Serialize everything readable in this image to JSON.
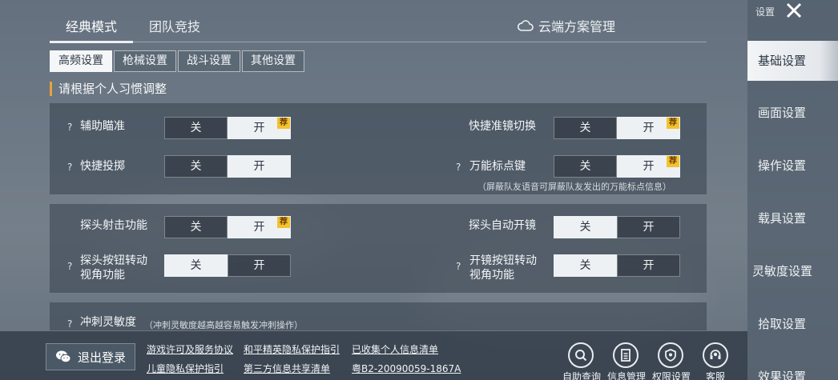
{
  "mode_tabs": [
    {
      "label": "经典模式",
      "active": true
    },
    {
      "label": "团队竞技",
      "active": false
    }
  ],
  "cloud_management": "云端方案管理",
  "sub_tabs": [
    {
      "label": "高频设置",
      "active": true
    },
    {
      "label": "枪械设置",
      "active": false
    },
    {
      "label": "战斗设置",
      "active": false
    },
    {
      "label": "其他设置",
      "active": false
    }
  ],
  "section_title": "请根据个人习惯调整",
  "toggle_labels": {
    "off": "关",
    "on": "开"
  },
  "recommend_badge": "荐",
  "help_glyph": "?",
  "settings": {
    "aim_assist": {
      "label": "辅助瞄准",
      "value": "开",
      "recommended": true
    },
    "quick_scope_switch": {
      "label": "快捷准镜切换",
      "value": "开",
      "recommended": true
    },
    "quick_throw": {
      "label": "快捷投掷",
      "value": "开"
    },
    "universal_marker": {
      "label": "万能标点键",
      "value": "开",
      "recommended": true,
      "note": "（屏蔽队友语音可屏蔽队友发出的万能标点信息）"
    },
    "peek_fire": {
      "label": "探头射击功能",
      "value": "开",
      "recommended": true
    },
    "peek_auto_scope": {
      "label": "探头自动开镜",
      "value": "关"
    },
    "peek_button_rotate": {
      "label_line1": "探头按钮转动",
      "label_line2": "视角功能",
      "value": "关"
    },
    "scope_button_rotate": {
      "label_line1": "开镜按钮转动",
      "label_line2": "视角功能",
      "value": "关"
    },
    "sprint_sensitivity": {
      "label": "冲刺灵敏度",
      "note": "（冲刺灵敏度越高越容易触发冲刺操作）"
    }
  },
  "footer": {
    "logout": "退出登录",
    "links": {
      "license": "游戏许可及服务协议",
      "privacy": "和平精英隐私保护指引",
      "collected": "已收集个人信息清单",
      "child_privacy": "儿童隐私保护指引",
      "third_party": "第三方信息共享清单",
      "icp": "粤B2-20090059-1867A"
    },
    "buttons": {
      "self_help": "自助查询",
      "info_mgmt": "信息管理",
      "permission": "权限设置",
      "service": "客服"
    }
  },
  "sidebar": {
    "header": "设置",
    "items": [
      {
        "label": "基础设置",
        "active": true
      },
      {
        "label": "画面设置",
        "active": false
      },
      {
        "label": "操作设置",
        "active": false
      },
      {
        "label": "载具设置",
        "active": false
      },
      {
        "label": "灵敏度设置",
        "active": false
      },
      {
        "label": "拾取设置",
        "active": false
      },
      {
        "label": "效果设置",
        "active": false
      }
    ]
  },
  "colors": {
    "accent_orange": "#e9a23b",
    "badge_yellow": "#f2c230",
    "toggle_on_bg": "#eef1f4"
  }
}
